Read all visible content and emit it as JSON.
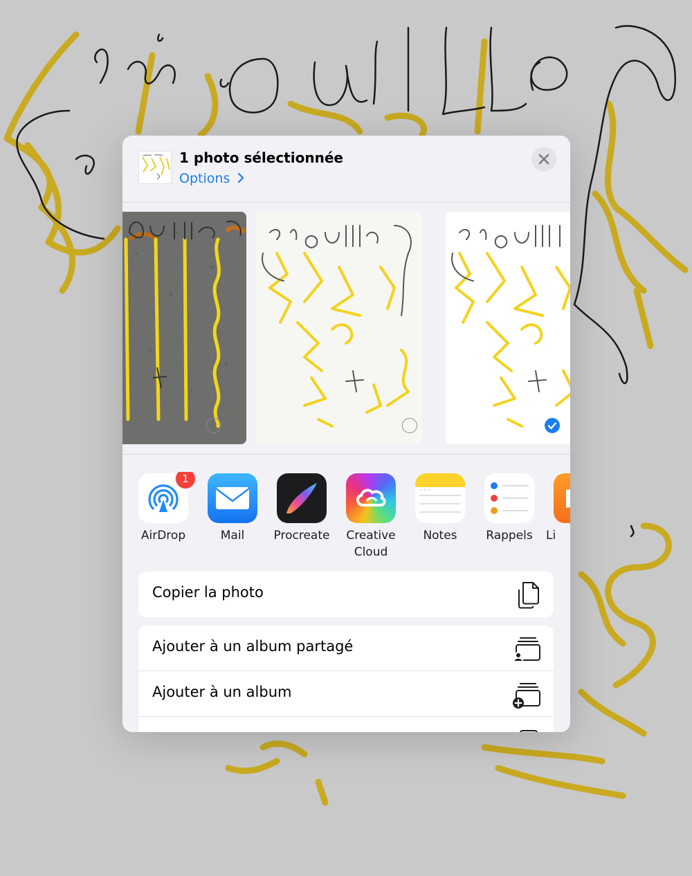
{
  "share_sheet": {
    "title": "1 photo sélectionnée",
    "options_label": "Options",
    "close_icon": "xmark-icon"
  },
  "photos": [
    {
      "selected": false
    },
    {
      "selected": false
    },
    {
      "selected": true
    }
  ],
  "apps": [
    {
      "label": "AirDrop",
      "icon": "airdrop-icon",
      "badge": "1"
    },
    {
      "label": "Mail",
      "icon": "mail-icon"
    },
    {
      "label": "Procreate",
      "icon": "procreate-icon"
    },
    {
      "label": "Creative\nCloud",
      "icon": "creative-cloud-icon"
    },
    {
      "label": "Notes",
      "icon": "notes-icon"
    },
    {
      "label": "Rappels",
      "icon": "reminders-icon"
    },
    {
      "label": "Li",
      "icon": "books-icon"
    }
  ],
  "actions": {
    "copy": {
      "label": "Copier la photo",
      "icon": "copy-doc-icon"
    },
    "shared_album": {
      "label": "Ajouter à un album partagé",
      "icon": "shared-album-icon"
    },
    "album": {
      "label": "Ajouter à un album",
      "icon": "add-album-icon"
    }
  },
  "colors": {
    "accent": "#1b7cf0",
    "badge": "#f2413a",
    "sketch_yellow": "#d4b81c",
    "sheet_bg": "#f2f2f6"
  }
}
